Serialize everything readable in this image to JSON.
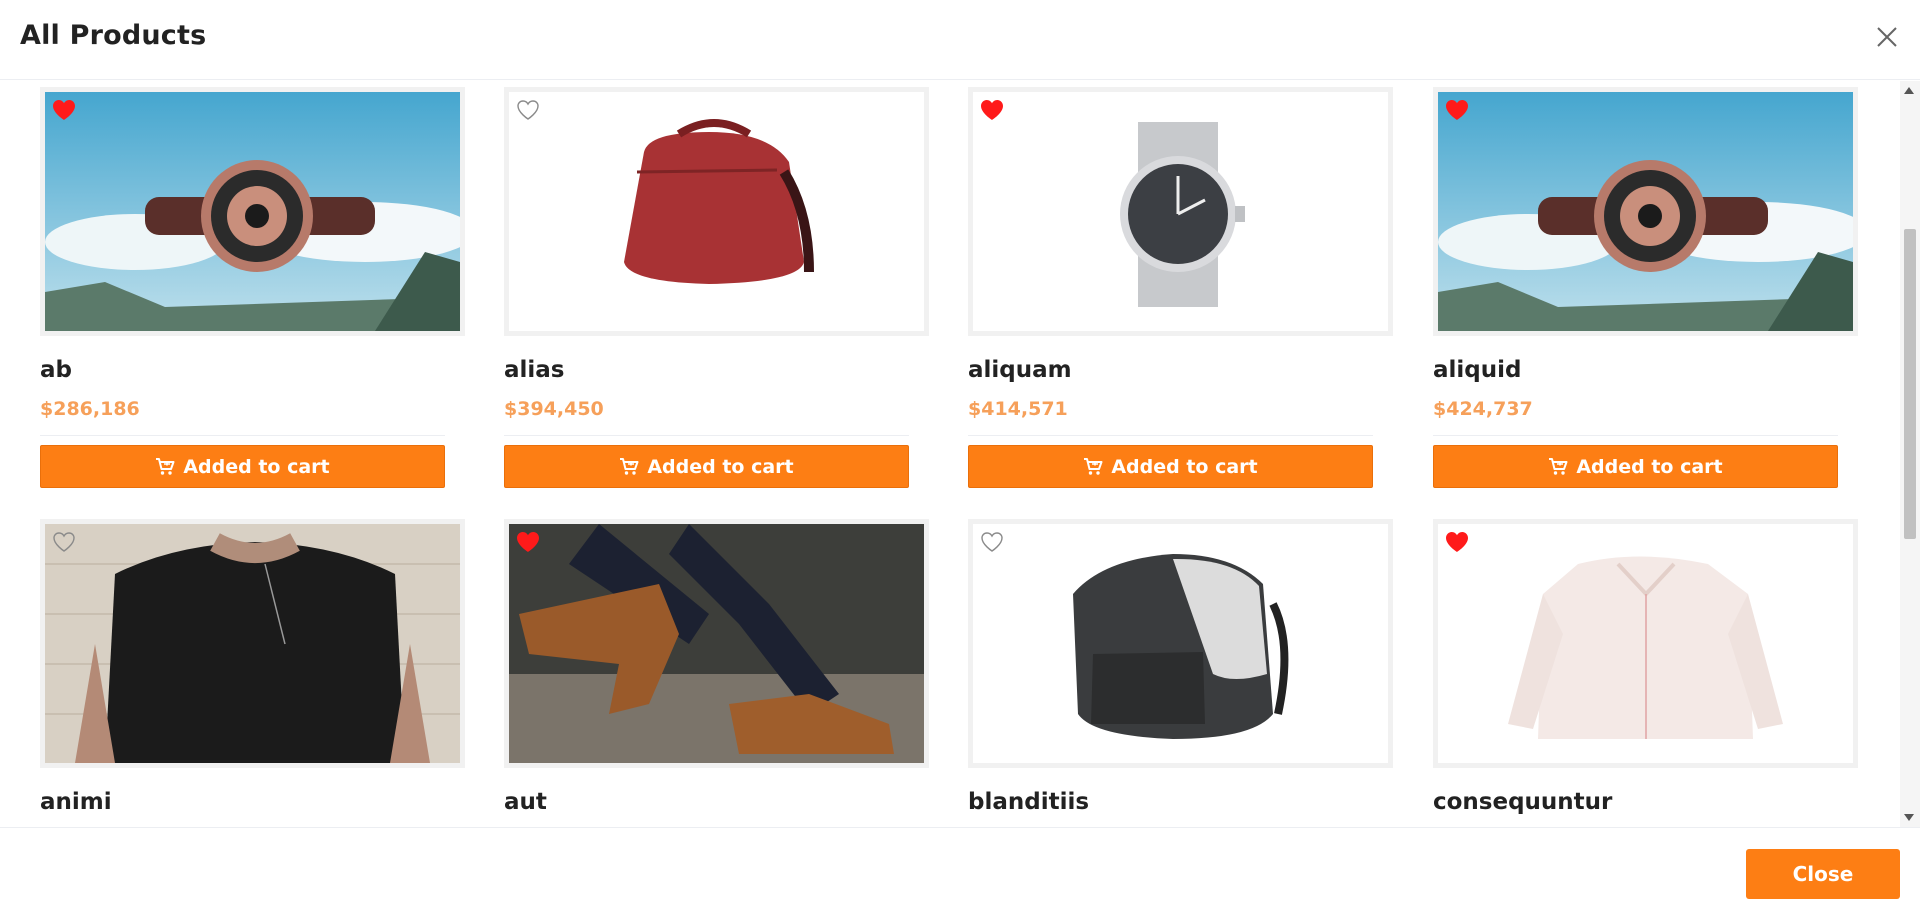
{
  "modal": {
    "title": "All Products",
    "close_button_label": "Close"
  },
  "colors": {
    "accent": "#fd7e14",
    "price": "#f6a05a",
    "heart_active": "#ff0000"
  },
  "products": [
    {
      "name": "ab",
      "price": "$286,186",
      "cart_label": "Added to cart",
      "favorited": true,
      "image": "watch-sky"
    },
    {
      "name": "alias",
      "price": "$394,450",
      "cart_label": "Added to cart",
      "favorited": false,
      "image": "red-backpack"
    },
    {
      "name": "aliquam",
      "price": "$414,571",
      "cart_label": "Added to cart",
      "favorited": true,
      "image": "silver-watch"
    },
    {
      "name": "aliquid",
      "price": "$424,737",
      "cart_label": "Added to cart",
      "favorited": true,
      "image": "watch-sky"
    },
    {
      "name": "animi",
      "price": "",
      "cart_label": "",
      "favorited": false,
      "image": "black-tshirt"
    },
    {
      "name": "aut",
      "price": "",
      "cart_label": "",
      "favorited": true,
      "image": "brown-boots"
    },
    {
      "name": "blanditiis",
      "price": "",
      "cart_label": "",
      "favorited": false,
      "image": "gray-backpack"
    },
    {
      "name": "consequuntur",
      "price": "",
      "cart_label": "",
      "favorited": true,
      "image": "white-shirt"
    }
  ]
}
